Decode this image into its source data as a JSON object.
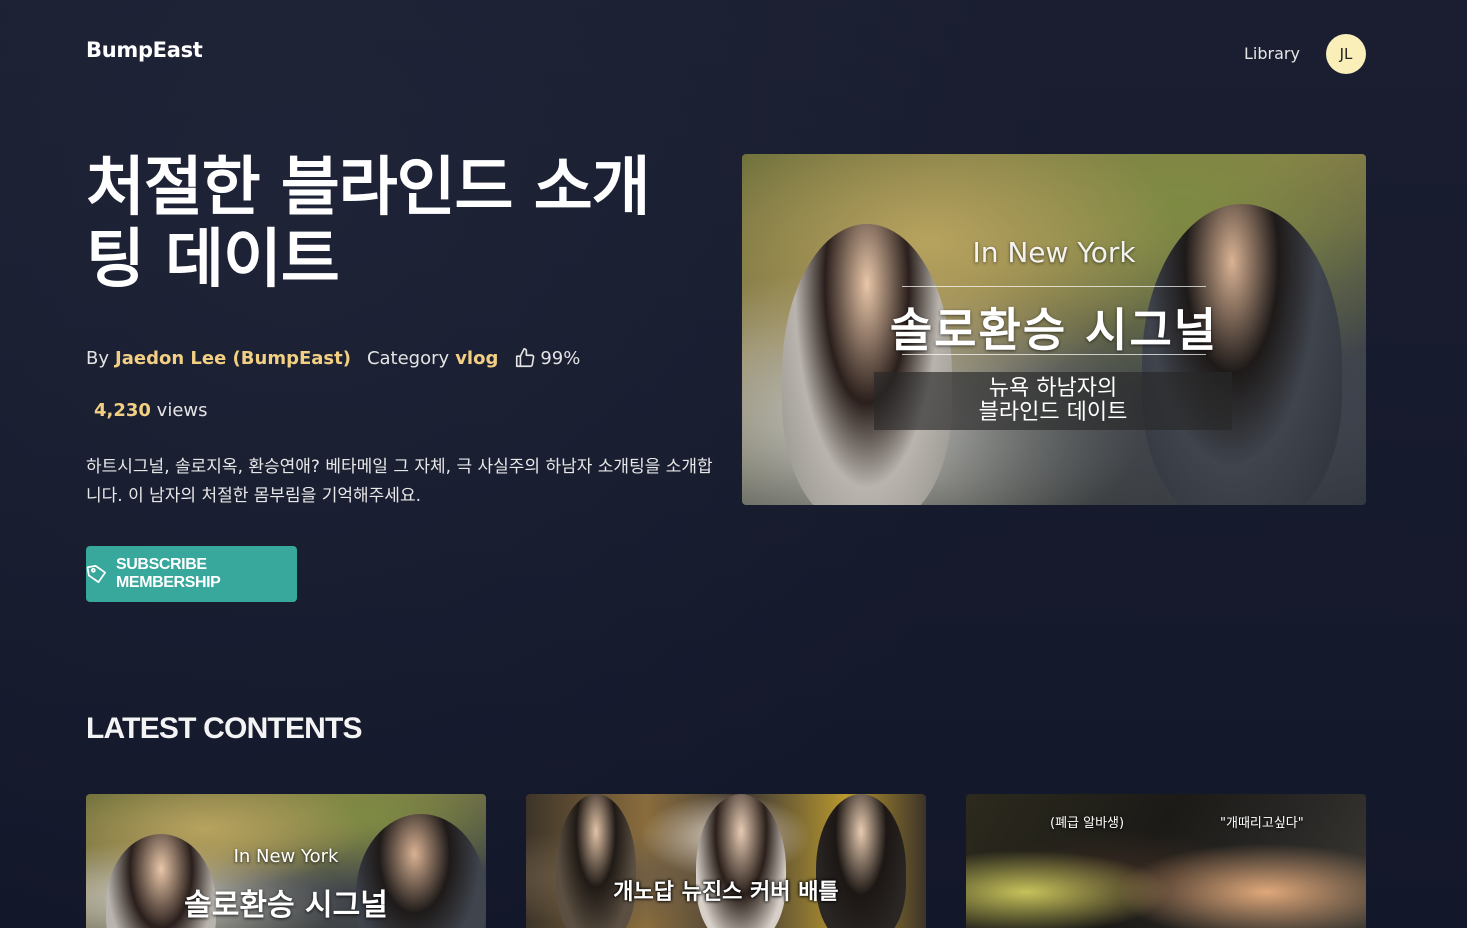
{
  "header": {
    "logo": "BumpEast",
    "nav_library": "Library",
    "avatar_initials": "JL"
  },
  "hero": {
    "title": "처절한 블라인드 소개팅 데이트",
    "by_label": "By",
    "author": "Jaedon Lee (BumpEast)",
    "category_label": "Category",
    "category": "vlog",
    "like_percent": "99%",
    "views_count": "4,230",
    "views_label": "views",
    "description": "하트시그널, 솔로지옥, 환승연애? 베타메일 그 자체, 극 사실주의 하남자 소개팅을 소개합니다. 이 남자의 처절한 몸부림을 기억해주세요.",
    "subscribe_label": "SUBSCRIBE MEMBERSHIP",
    "image": {
      "city_text": "In New York",
      "title_text": "솔로환승 시그널",
      "box_line1": "뉴욕 하남자의",
      "box_line2": "블라인드 데이트"
    }
  },
  "latest": {
    "title": "LATEST CONTENTS",
    "cards": [
      {
        "caption_top": "In New York",
        "caption_main": "솔로환승 시그널"
      },
      {
        "caption_main": "개노답 뉴진스 커버 배틀"
      },
      {
        "caption_left": "(폐급 알바생)",
        "caption_right": "\"개때리고싶다\""
      }
    ]
  },
  "colors": {
    "background": "#171b2c",
    "accent_text": "#f2cf83",
    "button": "#38a79c",
    "avatar": "#fbefb9"
  }
}
